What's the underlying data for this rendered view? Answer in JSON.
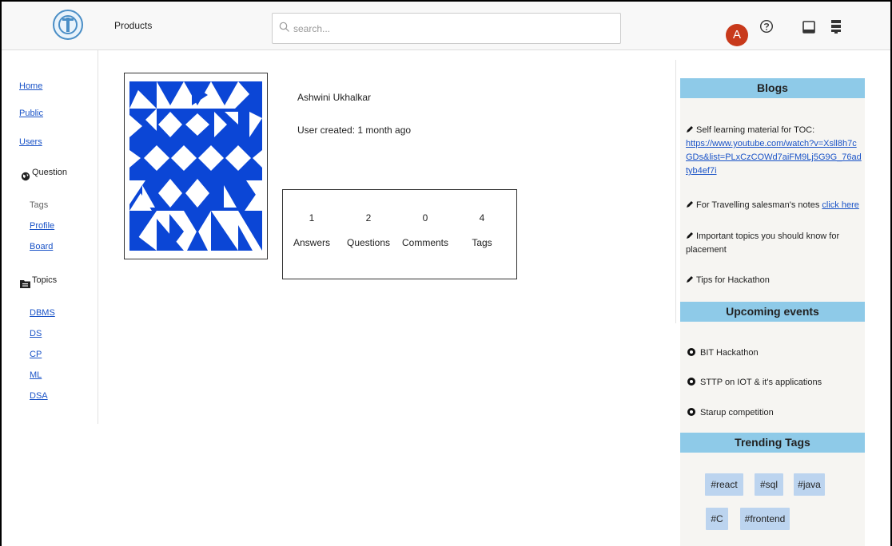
{
  "header": {
    "products_label": "Products",
    "search_placeholder": "search...",
    "avatar_letter": "A",
    "avatar_color": "#c8391b"
  },
  "sidebar": {
    "links": [
      "Home",
      "Public",
      "Users"
    ],
    "question_label": "Question",
    "tags_label": "Tags",
    "profile_label": "Profile",
    "board_label": "Board",
    "topics_label": "Topics",
    "topics": [
      "DBMS",
      "DS",
      "CP",
      "ML",
      "DSA"
    ]
  },
  "profile": {
    "name": "Ashwini Ukhalkar",
    "created": "User created: 1 month ago",
    "stats": [
      {
        "value": "1",
        "label": "Answers"
      },
      {
        "value": "2",
        "label": "Questions"
      },
      {
        "value": "0",
        "label": "Comments"
      },
      {
        "value": "4",
        "label": "Tags"
      }
    ]
  },
  "blogs": {
    "title": "Blogs",
    "item1_text": "Self learning material for TOC:",
    "item1_link": "https://www.youtube.com/watch?v=Xsll8h7cGDs&list=PLxCzCOWd7aiFM9Lj5G9G_76adtyb4ef7i",
    "item2_text": "For Travelling salesman's notes",
    "item2_link": "click here",
    "item3_text": "Important topics you should know for placement",
    "item4_text": "Tips for Hackathon"
  },
  "events": {
    "title": "Upcoming events",
    "items": [
      "BIT Hackathon",
      "STTP on IOT & it's applications",
      "Starup competition"
    ]
  },
  "trending": {
    "title": "Trending Tags",
    "tags": [
      "#react",
      "#sql",
      "#java",
      "#C",
      "#frontend"
    ]
  },
  "colors": {
    "accent_blue": "#8ecae8",
    "link": "#1a53c7",
    "tag_bg": "#bcd4ef",
    "identicon": "#0b46d6"
  }
}
